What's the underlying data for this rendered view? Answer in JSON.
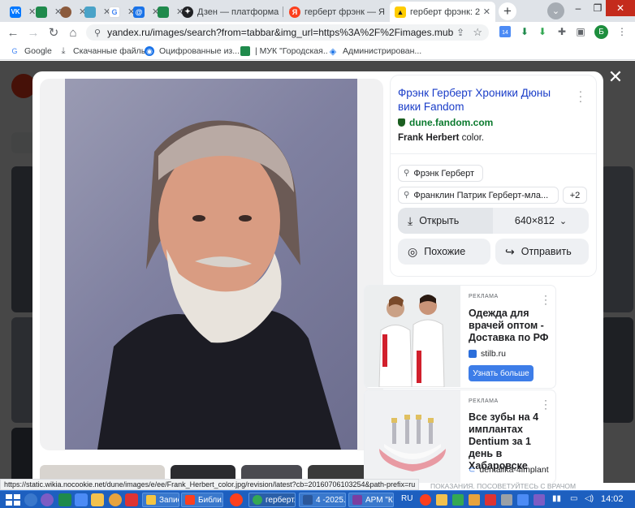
{
  "browser": {
    "tabs": [
      {
        "title": "",
        "icon": "vk-icon",
        "color": "#0077ff",
        "glyph": "VK"
      },
      {
        "title": "",
        "icon": "green-leaf-icon",
        "color": "#1f8a4c",
        "glyph": ""
      },
      {
        "title": "",
        "icon": "avatar-icon",
        "color": "#8b5a3c",
        "glyph": ""
      },
      {
        "title": "",
        "icon": "image-tab-icon",
        "color": "#4aa3c8",
        "glyph": ""
      },
      {
        "title": "",
        "icon": "google-icon",
        "color": "#ffffff",
        "glyph": "G"
      },
      {
        "title": "",
        "icon": "at-mail-icon",
        "color": "#1a73e8",
        "glyph": "@"
      },
      {
        "title": "",
        "icon": "green-leaf-icon",
        "color": "#1f8a4c",
        "glyph": ""
      },
      {
        "title": "Дзен — платформа",
        "icon": "dzen-icon",
        "color": "#202124",
        "glyph": "✦"
      },
      {
        "title": "герберт фрэнк — Я",
        "icon": "yandex-icon",
        "color": "#fc3f1d",
        "glyph": "Я"
      },
      {
        "title": "герберт фрэнк: 2 ты",
        "icon": "yandex-images-icon",
        "color": "#ffcc00",
        "glyph": "▲"
      }
    ],
    "url": "yandex.ru/images/search?from=tabbar&img_url=https%3A%2F%2Fimages.mubicdn.n...",
    "bookmarks": [
      {
        "label": "Google",
        "color": "#4285f4",
        "glyph": "G"
      },
      {
        "label": "Скачанные файлы",
        "color": "#5f6368",
        "glyph": "⤓"
      },
      {
        "label": "Оцифрованные из...",
        "color": "#1a73e8",
        "glyph": "◉"
      },
      {
        "label": "| МУК \"Городская...",
        "color": "#1f8a4c",
        "glyph": ""
      },
      {
        "label": "Администрирован...",
        "color": "#1a73e8",
        "glyph": "◈"
      }
    ],
    "extension_badge": "14",
    "profile_initial": "Б"
  },
  "result_card": {
    "title": "Фрэнк Герберт Хроники Дюны вики Fandom",
    "domain": "dune.fandom.com",
    "desc_bold": "Frank Herbert",
    "desc_rest": " color.",
    "chips": [
      "Фрэнк Герберт",
      "Франклин Патрик Герберт-мла..."
    ],
    "more_chip": "+2",
    "open_label": "Открыть",
    "size_label": "640×812",
    "similar_label": "Похожие",
    "share_label": "Отправить"
  },
  "ads": [
    {
      "label": "РЕКЛАМА",
      "title": "Одежда для врачей оптом - Доставка по РФ",
      "domain": "stilb.ru",
      "cta": "Узнать больше"
    },
    {
      "label": "РЕКЛАМА",
      "title": "Все зубы на 4 имплантах Dentium за 1 день в Хабаровске",
      "domain": "dentalika-4implant"
    }
  ],
  "status_url": "https://static.wikia.nocookie.net/dune/images/e/ee/Frank_Herbert_color.jpg/revision/latest?cb=20160706103254&path-prefix=ru",
  "disclaimer": "ПОКАЗАНИЯ. ПОСОВЕТУЙТЕСЬ С ВРАЧОМ",
  "taskbar": {
    "tasks": [
      {
        "label": "Записки",
        "color": "#f5c542"
      },
      {
        "label": "Библи...",
        "color": "#fc3f1d"
      },
      {
        "label": "герберт...",
        "color": "#34a853"
      },
      {
        "label": "4 -2025...",
        "color": "#2b579a"
      },
      {
        "label": "АРМ \"К...",
        "color": "#7a3ea0"
      }
    ],
    "lang": "RU",
    "time": "14:02"
  }
}
